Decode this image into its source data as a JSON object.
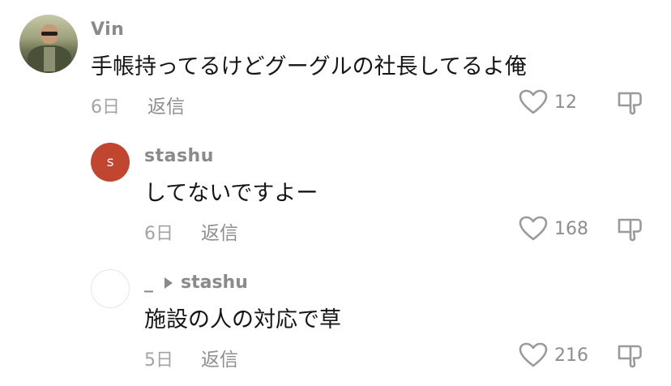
{
  "comments": [
    {
      "username": "Vin",
      "text": "手帳持ってるけどグーグルの社長してるよ俺",
      "date": "6日",
      "reply_label": "返信",
      "likes": "12",
      "avatar": "photo-avatar"
    },
    {
      "username": "stashu",
      "avatar_letter": "s",
      "avatar_color": "#c0462f",
      "text": "してないですよー",
      "date": "6日",
      "reply_label": "返信",
      "likes": "168"
    },
    {
      "username": "_",
      "reply_to": "stashu",
      "text": "施設の人の対応で草",
      "date": "5日",
      "reply_label": "返信",
      "likes": "216",
      "avatar": "blank-avatar"
    }
  ],
  "icons": {
    "like": "heart-outline-icon",
    "dislike": "thumbs-down-icon",
    "reply_arrow": "play-arrow-icon"
  },
  "colors": {
    "username": "#8a8a8a",
    "text": "#161616",
    "meta": "#a3a3a3",
    "icon": "#9a9a9a"
  }
}
